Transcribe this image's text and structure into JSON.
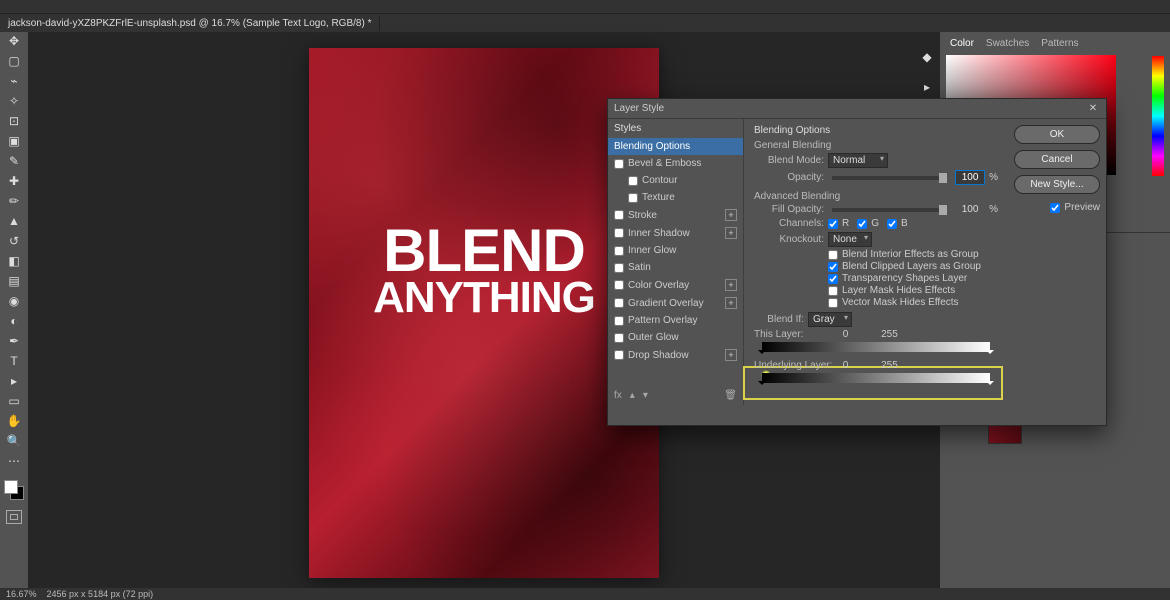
{
  "tab": {
    "label": "jackson-david-yXZ8PKZFrlE-unsplash.psd @ 16.7% (Sample Text Logo, RGB/8) *"
  },
  "canvas": {
    "line1": "BLEND",
    "line2": "ANYTHING"
  },
  "status": {
    "zoom": "16.67%",
    "doc": "2456 px x 5184 px (72 ppi)"
  },
  "colorPanel": {
    "tabs": [
      "Color",
      "Swatches",
      "Patterns"
    ],
    "active": "Color"
  },
  "dialog": {
    "title": "Layer Style",
    "stylesHeader": "Styles",
    "blendingOptions": "Blending Options",
    "styles": [
      {
        "label": "Bevel & Emboss",
        "checked": false,
        "add": false
      },
      {
        "label": "Contour",
        "checked": false,
        "add": false,
        "indent": true
      },
      {
        "label": "Texture",
        "checked": false,
        "add": false,
        "indent": true
      },
      {
        "label": "Stroke",
        "checked": false,
        "add": true
      },
      {
        "label": "Inner Shadow",
        "checked": false,
        "add": true
      },
      {
        "label": "Inner Glow",
        "checked": false,
        "add": false
      },
      {
        "label": "Satin",
        "checked": false,
        "add": false
      },
      {
        "label": "Color Overlay",
        "checked": false,
        "add": true
      },
      {
        "label": "Gradient Overlay",
        "checked": false,
        "add": true
      },
      {
        "label": "Pattern Overlay",
        "checked": false,
        "add": false
      },
      {
        "label": "Outer Glow",
        "checked": false,
        "add": false
      },
      {
        "label": "Drop Shadow",
        "checked": false,
        "add": true
      }
    ],
    "options": {
      "heading": "Blending Options",
      "general": "General Blending",
      "blendModeLabel": "Blend Mode:",
      "blendMode": "Normal",
      "opacityLabel": "Opacity:",
      "opacity": "100",
      "pct": "%",
      "advanced": "Advanced Blending",
      "fillOpacityLabel": "Fill Opacity:",
      "fillOpacity": "100",
      "channelsLabel": "Channels:",
      "chR": "R",
      "chG": "G",
      "chB": "B",
      "knockoutLabel": "Knockout:",
      "knockout": "None",
      "adv1": "Blend Interior Effects as Group",
      "adv2": "Blend Clipped Layers as Group",
      "adv3": "Transparency Shapes Layer",
      "adv4": "Layer Mask Hides Effects",
      "adv5": "Vector Mask Hides Effects",
      "blendIfLabel": "Blend If:",
      "blendIf": "Gray",
      "thisLayerLabel": "This Layer:",
      "thisLayerMin": "0",
      "thisLayerMax": "255",
      "underLayerLabel": "Underlying Layer:",
      "underLayerMin": "0",
      "underLayerMax": "255"
    },
    "buttons": {
      "ok": "OK",
      "cancel": "Cancel",
      "newStyle": "New Style...",
      "preview": "Preview"
    }
  }
}
